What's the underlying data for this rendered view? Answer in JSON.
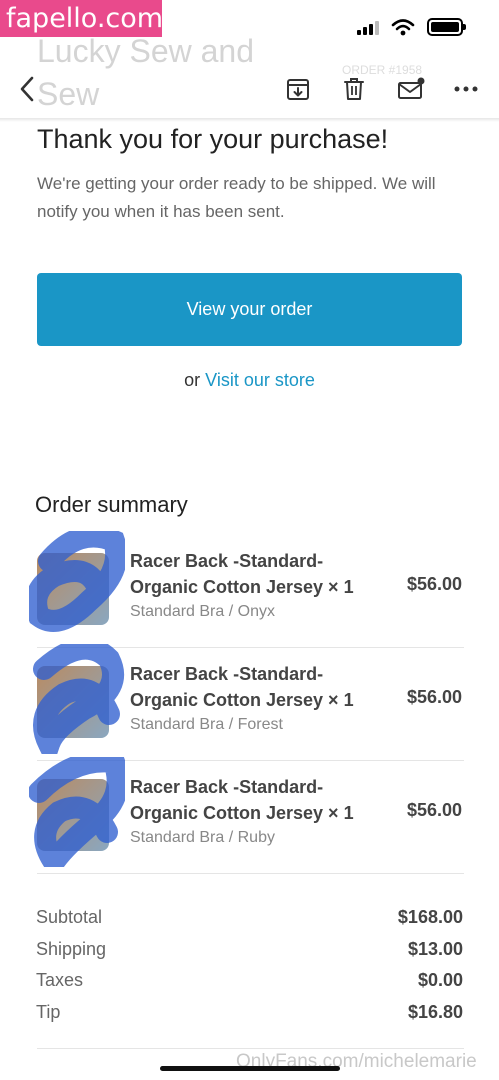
{
  "watermark": "fapello.com",
  "status_bar": {
    "signal_icon": "signal-icon",
    "wifi_icon": "wifi-icon",
    "battery_icon": "battery-icon"
  },
  "header": {
    "sender_title": "Lucky Sew and Sew",
    "order_tag": "ORDER #1958",
    "icons": [
      "back-chevron-icon",
      "archive-icon",
      "trash-icon",
      "mail-icon",
      "more-icon"
    ]
  },
  "email": {
    "heading": "Thank you for your purchase!",
    "intro": "We're getting your order ready to be shipped. We will notify you when it has been sent.",
    "view_order_label": "View your order",
    "store_prefix": "or",
    "store_link": "Visit our store",
    "accent_color": "#1a96c6"
  },
  "order_summary": {
    "title": "Order summary",
    "items": [
      {
        "name": "Racer Back -Standard- Organic Cotton Jersey × 1",
        "variant": "Standard Bra / Onyx",
        "price": "$56.00"
      },
      {
        "name": "Racer Back -Standard- Organic Cotton Jersey × 1",
        "variant": "Standard Bra / Forest",
        "price": "$56.00"
      },
      {
        "name": "Racer Back -Standard- Organic Cotton Jersey × 1",
        "variant": "Standard Bra / Ruby",
        "price": "$56.00"
      }
    ],
    "totals": [
      {
        "label": "Subtotal",
        "value": "$168.00"
      },
      {
        "label": "Shipping",
        "value": "$13.00"
      },
      {
        "label": "Taxes",
        "value": "$0.00"
      },
      {
        "label": "Tip",
        "value": "$16.80"
      }
    ]
  },
  "footer_watermark": "OnlyFans.com/michelemarie"
}
